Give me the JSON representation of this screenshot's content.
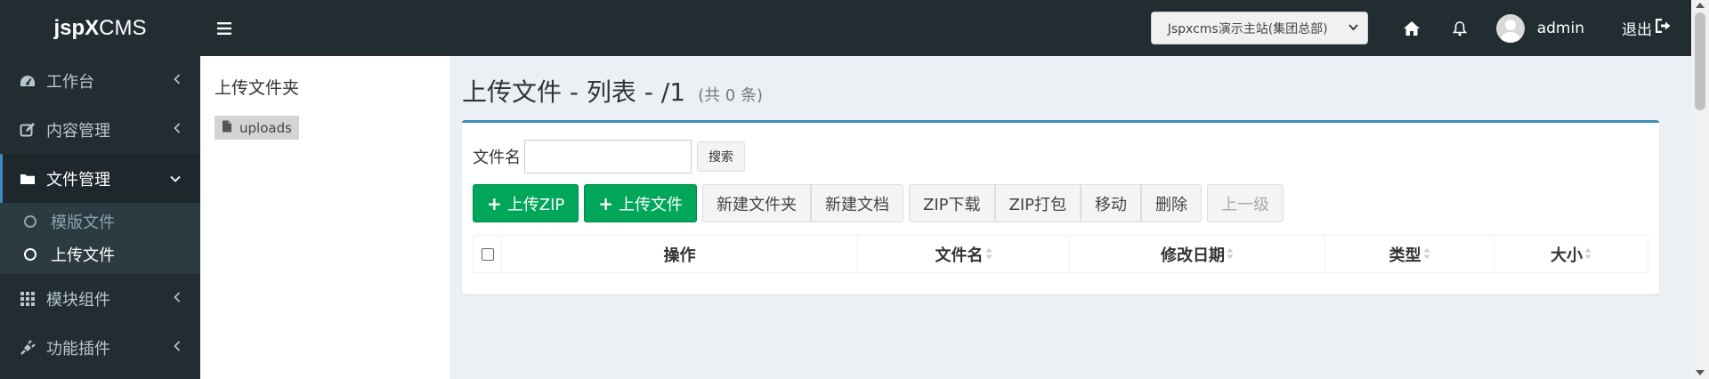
{
  "header": {
    "logo_bold": "jspX",
    "logo_rest": "CMS",
    "site_select": "Jspxcms演示主站(集团总部)",
    "username": "admin",
    "logout_label": "退出"
  },
  "sidebar": {
    "items": [
      {
        "label": "工作台",
        "icon": "dashboard-icon"
      },
      {
        "label": "内容管理",
        "icon": "edit-icon"
      },
      {
        "label": "文件管理",
        "icon": "folder-icon"
      },
      {
        "label": "模块组件",
        "icon": "grid-icon"
      },
      {
        "label": "功能插件",
        "icon": "plug-icon"
      }
    ],
    "sub_items": [
      {
        "label": "模版文件"
      },
      {
        "label": "上传文件"
      }
    ]
  },
  "folder_panel": {
    "title": "上传文件夹",
    "root": "uploads"
  },
  "page": {
    "title": "上传文件 - 列表 - /1",
    "count": "(共 0 条)"
  },
  "search": {
    "label": "文件名",
    "value": "",
    "button": "搜索"
  },
  "toolbar": {
    "upload_zip": "上传ZIP",
    "upload_file": "上传文件",
    "new_folder": "新建文件夹",
    "new_doc": "新建文档",
    "zip_download": "ZIP下载",
    "zip_pack": "ZIP打包",
    "move": "移动",
    "delete": "删除",
    "up_level": "上一级"
  },
  "table": {
    "columns": [
      "操作",
      "文件名",
      "修改日期",
      "类型",
      "大小"
    ]
  },
  "colors": {
    "sidebar_bg": "#222d32",
    "accent": "#3c8dbc",
    "success": "#00a65a"
  }
}
